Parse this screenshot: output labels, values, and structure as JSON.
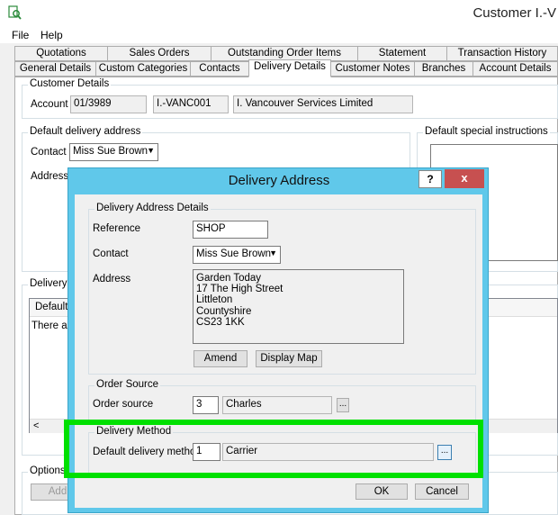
{
  "window": {
    "title": "Customer I.-V"
  },
  "menu": {
    "file": "File",
    "help": "Help"
  },
  "tabs_row1": [
    "Quotations",
    "Sales Orders",
    "Outstanding Order Items",
    "Statement",
    "Transaction History"
  ],
  "tabs_row2": [
    "General Details",
    "Custom Categories",
    "Contacts",
    "Delivery Details",
    "Customer Notes",
    "Branches",
    "Account Details"
  ],
  "customer_details": {
    "title": "Customer Details",
    "account_label": "Account",
    "account_number": "01/3989",
    "account_code": "I.-VANC001",
    "account_name": "I. Vancouver Services Limited"
  },
  "default_delivery": {
    "title": "Default delivery address",
    "contact_label": "Contact",
    "contact_value": "Miss Sue Brown",
    "address_label": "Address"
  },
  "special_instructions": {
    "title": "Default special instructions"
  },
  "background_fragments": {
    "delivery_addresses_title": "Delivery A",
    "list_header": "Default",
    "list_empty": "There are",
    "scroll_left": "<",
    "options_title": "Options",
    "add_button": "Add"
  },
  "dialog": {
    "title": "Delivery Address",
    "help": "?",
    "close": "x",
    "details_group": "Delivery Address Details",
    "reference_label": "Reference",
    "reference_value": "SHOP",
    "contact_label": "Contact",
    "contact_value": "Miss Sue Brown",
    "address_label": "Address",
    "address_lines": [
      "Garden Today",
      "17 The High Street",
      "Littleton",
      "Countyshire",
      "CS23 1KK"
    ],
    "amend": "Amend",
    "display_map": "Display Map",
    "order_source_group": "Order Source",
    "order_source_label": "Order source",
    "order_source_code": "3",
    "order_source_name": "Charles",
    "browse": "...",
    "delivery_method_group": "Delivery Method",
    "delivery_method_label": "Default delivery method",
    "delivery_method_code": "1",
    "delivery_method_name": "Carrier",
    "ok": "OK",
    "cancel": "Cancel"
  },
  "colors": {
    "dialog_frame": "#60c8ea",
    "close_button": "#c75050",
    "highlight": "#00e000"
  }
}
